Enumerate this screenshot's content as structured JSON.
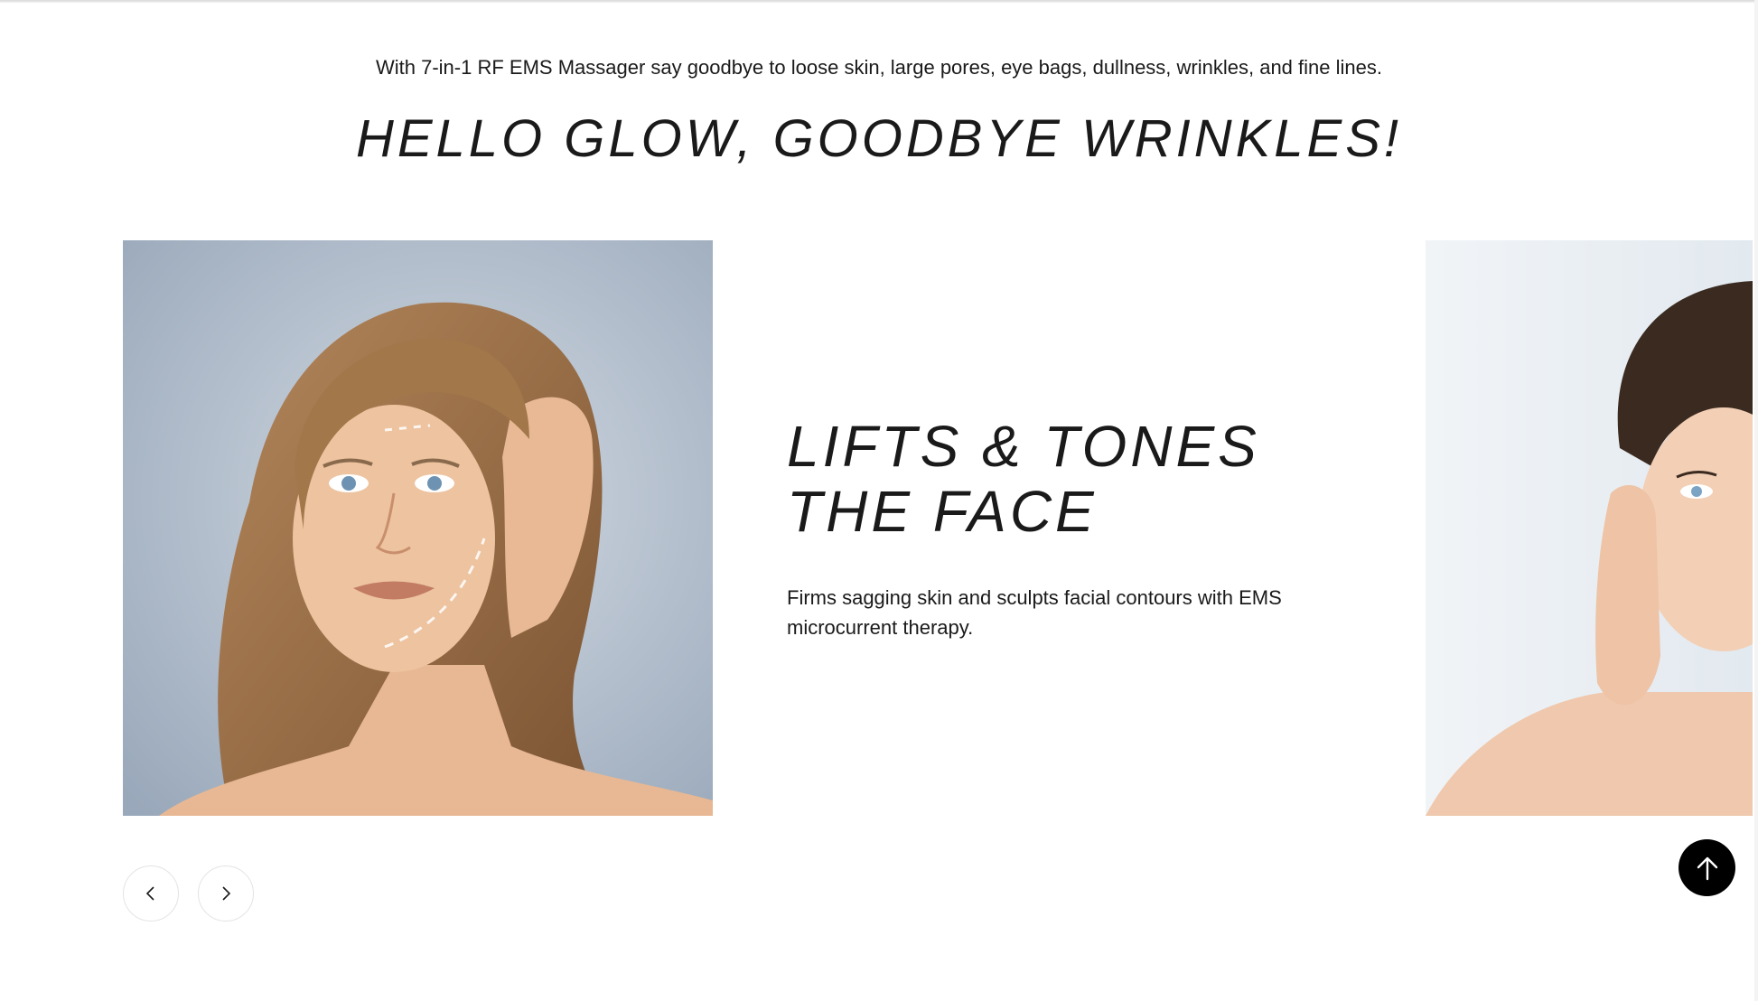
{
  "intro": {
    "text": "With 7-in-1 RF EMS Massager say goodbye to loose skin, large pores, eye bags, dullness, wrinkles, and fine lines."
  },
  "headline": "HELLO GLOW, GOODBYE WRINKLES!",
  "slide": {
    "title_line1": "LIFTS & TONES",
    "title_line2": "THE FACE",
    "description": "Firms sagging skin and sculpts facial contours with EMS microcurrent therapy."
  },
  "icons": {
    "prev": "chevron-left-icon",
    "next": "chevron-right-icon",
    "back_to_top": "arrow-up-icon"
  },
  "colors": {
    "text": "#1a1a1a",
    "back_to_top_bg": "#000000",
    "nav_border": "#e3e3e3"
  }
}
